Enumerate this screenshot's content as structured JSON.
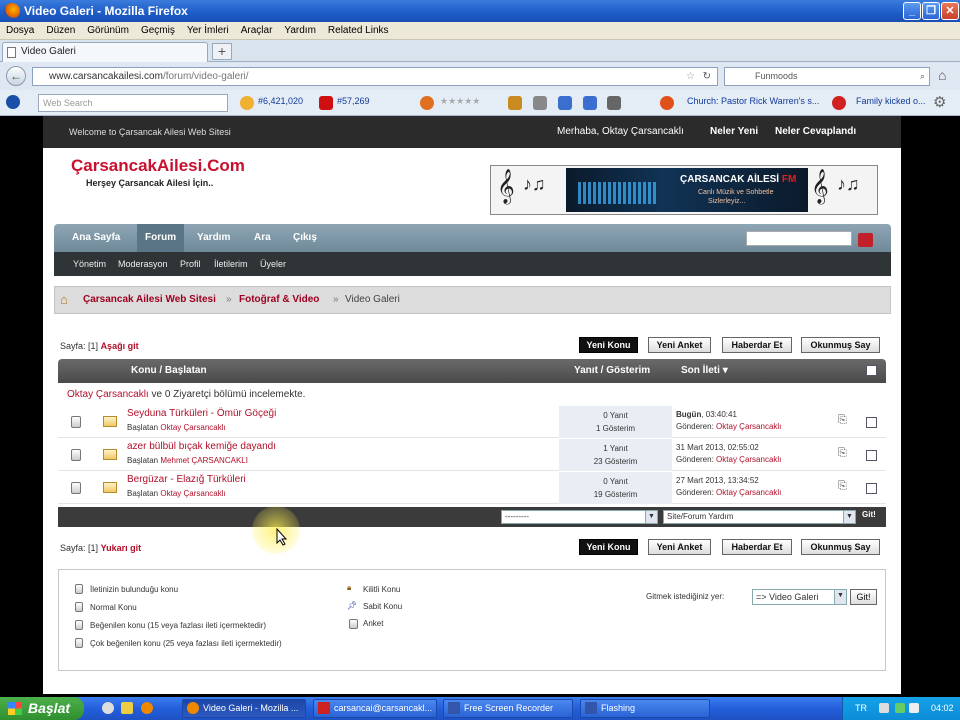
{
  "window": {
    "title": "Video Galeri - Mozilla Firefox"
  },
  "menu": [
    "Dosya",
    "Düzen",
    "Görünüm",
    "Geçmiş",
    "Yer İmleri",
    "Araçlar",
    "Yardım",
    "Related Links"
  ],
  "tab": {
    "label": "Video Galeri",
    "new_tab": "+"
  },
  "nav": {
    "url_host": "www.carsancakailesi.com",
    "url_path": "/forum/video-galeri/",
    "search_engine": "Funmoods"
  },
  "toolbar": {
    "search_placeholder": "Web Search",
    "count1": "#6,421,020",
    "count2": "#57,269",
    "link1": "Church: Pastor Rick Warren's s...",
    "link2": "Family kicked o..."
  },
  "site": {
    "welcome": "Welcome to Çarsancak Ailesi Web Sitesi",
    "greeting": "Merhaba, Oktay Çarsancaklı",
    "new_posts": "Neler Yeni",
    "new_replies": "Neler Cevaplandı",
    "logo": "ÇarsancakAilesi.Com",
    "slogan": "Herşey Çarsancak Ailesi İçin..",
    "banner": {
      "title": "ÇARSANCAK AİLESİ",
      "fm": "FM",
      "sub1": "Canlı Müzik ve Sohbetle",
      "sub2": "Sizlerleyiz..."
    }
  },
  "mainnav": [
    "Ana Sayfa",
    "Forum",
    "Yardım",
    "Ara",
    "Çıkış"
  ],
  "subnav": [
    "Yönetim",
    "Moderasyon",
    "Profil",
    "İletilerim",
    "Üyeler"
  ],
  "breadcrumb": [
    "Çarsancak Ailesi Web Sitesi",
    "Fotoğraf & Video",
    "Video Galeri"
  ],
  "paging": {
    "label": "Sayfa:",
    "page": "[1]",
    "down": "Aşağı git",
    "up": "Yukarı git"
  },
  "actions": {
    "new_topic": "Yeni Konu",
    "new_poll": "Yeni Anket",
    "notify": "Haberdar Et",
    "mark_read": "Okunmuş Say"
  },
  "table": {
    "col_topic": "Konu / Başlatan",
    "col_stats": "Yanıt / Gösterim",
    "col_last": "Son İleti",
    "viewers_user": "Oktay Çarsancaklı",
    "viewers_rest": "ve 0 Ziyaretçi bölümü incelemekte.",
    "rows": [
      {
        "title": "Seyduna Türküleri - Ömür Göçeği",
        "starter_label": "Başlatan",
        "starter": "Oktay Çarsancaklı",
        "replies": "0 Yanıt",
        "views": "1 Gösterim",
        "last_date": "Bugün",
        "last_time": ", 03:40:41",
        "sender_label": "Gönderen:",
        "sender": "Oktay Çarsancaklı"
      },
      {
        "title": "azer bülbül bıçak kemiğe dayandı",
        "starter_label": "Başlatan",
        "starter": "Mehmet ÇARSANCAKLI",
        "replies": "1 Yanıt",
        "views": "23 Gösterim",
        "last_date": "",
        "last_time": "31 Mart 2013, 02:55:02",
        "sender_label": "Gönderen:",
        "sender": "Oktay Çarsancaklı"
      },
      {
        "title": "Bergüzar - Elazığ Türküleri",
        "starter_label": "Başlatan",
        "starter": "Oktay Çarsancaklı",
        "replies": "0 Yanıt",
        "views": "19 Gösterim",
        "last_date": "",
        "last_time": "27 Mart 2013, 13:34:52",
        "sender_label": "Gönderen:",
        "sender": "Oktay Çarsancaklı"
      }
    ],
    "footer_select1": "---------",
    "footer_select2": "Site/Forum Yardım",
    "footer_go": "Git!"
  },
  "legend": {
    "items_left": [
      "İletinizin bulunduğu konu",
      "Normal Konu",
      "Beğenilen konu (15 veya fazlası ileti içermektedir)",
      "Çok beğenilen konu (25 veya fazlası ileti içermektedir)"
    ],
    "items_right": [
      "Kilitli Konu",
      "Sabit Konu",
      "Anket"
    ],
    "jump_label": "Gitmek istediğiniz yer:",
    "jump_value": "=> Video Galeri",
    "jump_go": "Git!"
  },
  "taskbar": {
    "start": "Başlat",
    "tasks": [
      "Video Galeri - Mozilla ...",
      "carsancai@carsancakl...",
      "Free Screen Recorder",
      "Flashing"
    ],
    "lang": "TR",
    "clock": "04:02"
  }
}
